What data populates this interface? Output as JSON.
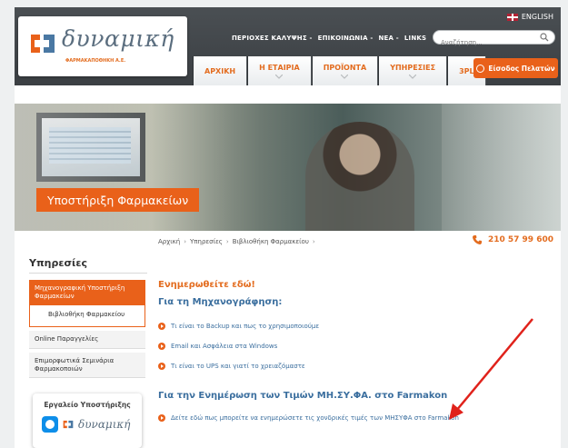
{
  "header": {
    "logo_text": "δυναμική",
    "logo_sub": "ΦΑΡΜΑΚΑΠΟΘΗΚΗ Α.Ε.",
    "language_label": "ENGLISH",
    "top_links": [
      "ΠΕΡΙΟΧΕΣ ΚΑΛΥΨΗΣ -",
      "ΕΠΙΚΟΙΝΩΝΙΑ -",
      "ΝΕΑ -",
      "LINKS"
    ],
    "search_placeholder": "Αναζήτηση...",
    "nav": [
      "ΑΡΧΙΚΗ",
      "Η ΕΤΑΙΡΙΑ",
      "ΠΡΟΪΟΝΤΑ",
      "ΥΠΗΡΕΣΙΕΣ",
      "3PL"
    ],
    "login_label": "Είσοδος Πελατών"
  },
  "hero": {
    "tag": "Υποστήριξη Φαρμακείων"
  },
  "breadcrumb": [
    "Αρχική",
    "Υπηρεσίες",
    "Βιβλιοθήκη Φαρμακείου"
  ],
  "phone": "210 57 99 600",
  "sidebar": {
    "title": "Υπηρεσίες",
    "active_item": "Μηχανογραφική Υποστήριξη Φαρμακείων",
    "sub_item": "Βιβλιοθήκη Φαρμακείου",
    "items": [
      "Online Παραγγελίες",
      "Επιμορφωτικά Σεμινάρια Φαρμακοποιών"
    ],
    "tool_title": "Εργαλείο Υποστήριξης",
    "tool_brand": "δυναμική"
  },
  "main": {
    "heading1": "Ενημερωθείτε εδώ!",
    "heading2": "Για τη Μηχανογράφηση:",
    "links": [
      "Τι είναι το Backup και πως το χρησιμοποιούμε",
      "Email και Ασφάλεια στα Windows",
      "Τι είναι το UPS και γιατί το χρειαζόμαστε"
    ],
    "heading3": "Για την Ενημέρωση των Τιμών ΜΗ.ΣΥ.ΦΑ. στο Farmakon",
    "link_final": "Δείτε εδώ πως μπορείτε να ενημερώσετε τις χονδρικές τιμές των ΜΗΣΥΦΑ στο Farmakon"
  },
  "colors": {
    "accent": "#e9611a",
    "link": "#3a6e9e",
    "header_bg": "#3f4347"
  }
}
